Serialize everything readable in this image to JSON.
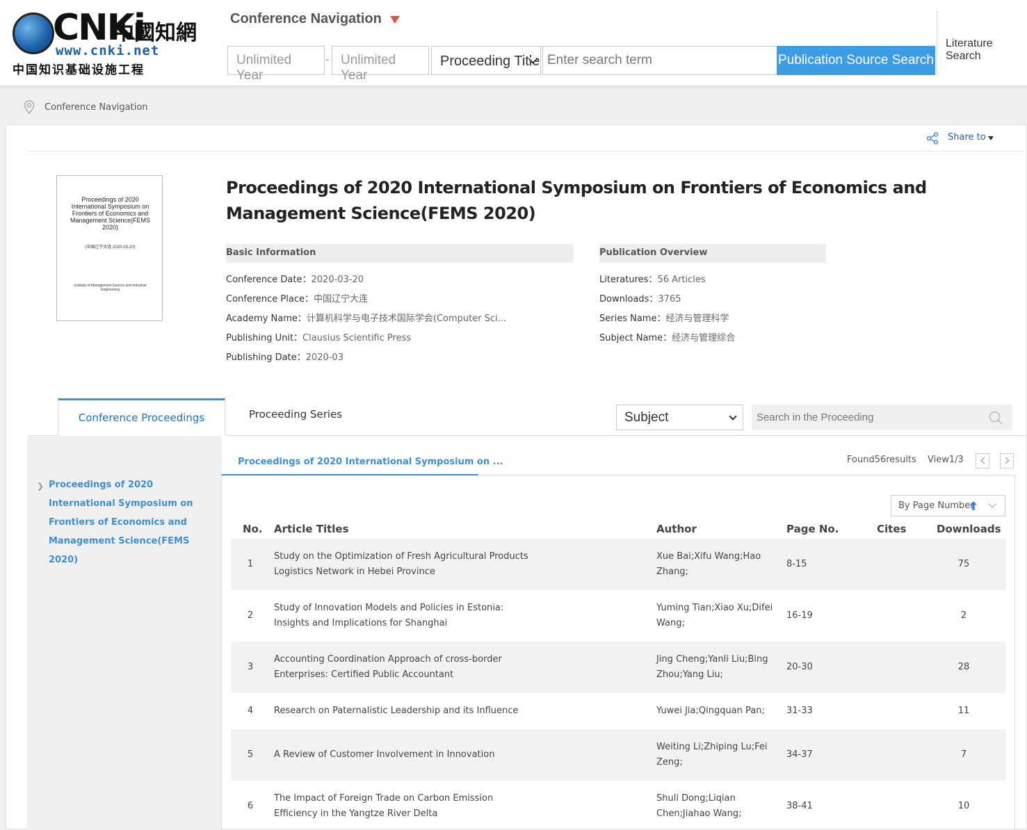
{
  "header": {
    "logo": {
      "brand": "CNKi",
      "cn_name": "中國知網",
      "url": "www.cnki.net",
      "subtitle": "中国知识基础设施工程"
    },
    "nav_title": "Conference Navigation",
    "year_from_placeholder": "Unlimited  Year",
    "year_to_placeholder": "Unlimited  Year",
    "year_separator": "-",
    "field_select": "Proceeding Title",
    "search_placeholder": "Enter search term",
    "search_button": "Publication Source Search",
    "literature_search": "Literature Search"
  },
  "breadcrumb": "Conference Navigation",
  "share_label": "Share to",
  "cover": {
    "title": "Proceedings of 2020 International Symposium on Frontiers of Economics and Management Science(FEMS 2020)",
    "middle": "(中国辽宁大连        2020-03-20)",
    "bottom": "Institute of Management Science and Industrial Engineering"
  },
  "proceeding_title": "Proceedings of 2020 International Symposium on Frontiers of Economics and Management Science(FEMS 2020)",
  "basic_info": {
    "heading": "Basic Information",
    "items": [
      {
        "key": "Conference Date：",
        "value": "2020-03-20"
      },
      {
        "key": "Conference Place：",
        "value": "中国辽宁大连"
      },
      {
        "key": "Academy Name：",
        "value": "计算机科学与电子技术国际学会(Computer Sci..."
      },
      {
        "key": "Publishing Unit：",
        "value": "Clausius Scientific Press"
      },
      {
        "key": "Publishing Date：",
        "value": "2020-03"
      }
    ]
  },
  "overview": {
    "heading": "Publication Overview",
    "items": [
      {
        "key": "Literatures：",
        "value": "56 Articles"
      },
      {
        "key": "Downloads：",
        "value": "3765"
      },
      {
        "key": "Series Name：",
        "value": "经济与管理科学"
      },
      {
        "key": "Subject Name：",
        "value": "经济与管理综合"
      }
    ]
  },
  "tabs": {
    "proceedings": "Conference Proceedings",
    "series": "Proceeding Series"
  },
  "subject_select": "Subject",
  "proceeding_search_placeholder": "Search in the Proceeding",
  "left_tree": {
    "item": "Proceedings of 2020 International Symposium on Frontiers of Economics and Management Science(FEMS 2020)"
  },
  "content_tab": "Proceedings of 2020 International Symposium on ...",
  "found_text": "Found56results",
  "view_text": "View1/3",
  "sort_label": "By Page Number",
  "table": {
    "headers": {
      "no": "No.",
      "title": "Article Titles",
      "author": "Author",
      "page": "Page No.",
      "cites": "Cites",
      "downloads": "Downloads"
    },
    "rows": [
      {
        "no": "1",
        "title": "Study on the Optimization of Fresh Agricultural Products Logistics Network in Hebei Province",
        "author": "Xue Bai;Xifu Wang;Hao Zhang;",
        "page": "8-15",
        "cites": "",
        "downloads": "75"
      },
      {
        "no": "2",
        "title": "Study of Innovation Models and Policies in Estonia: Insights and Implications for Shanghai",
        "author": "Yuming Tian;Xiao Xu;Difei Wang;",
        "page": "16-19",
        "cites": "",
        "downloads": "2"
      },
      {
        "no": "3",
        "title": "Accounting Coordination Approach of cross-border Enterprises: Certified Public Accountant",
        "author": "Jing Cheng;Yanli Liu;Bing Zhou;Yang Liu;",
        "page": "20-30",
        "cites": "",
        "downloads": "28"
      },
      {
        "no": "4",
        "title": "Research on Paternalistic Leadership and its Influence",
        "author": "Yuwei Jia;Qingquan Pan;",
        "page": "31-33",
        "cites": "",
        "downloads": "11"
      },
      {
        "no": "5",
        "title": "A Review of Customer Involvement in Innovation",
        "author": "Weiting Li;Zhiping Lu;Fei Zeng;",
        "page": "34-37",
        "cites": "",
        "downloads": "7"
      },
      {
        "no": "6",
        "title": "The Impact of Foreign Trade on Carbon Emission Efficiency in the Yangtze River Delta",
        "author": "Shuli Dong;Liqian Chen;Jiahao Wang;",
        "page": "38-41",
        "cites": "",
        "downloads": "10"
      }
    ]
  },
  "colors": {
    "accent": "#3c9ce5",
    "link": "#3c8fd8",
    "caret": "#e0553a"
  }
}
